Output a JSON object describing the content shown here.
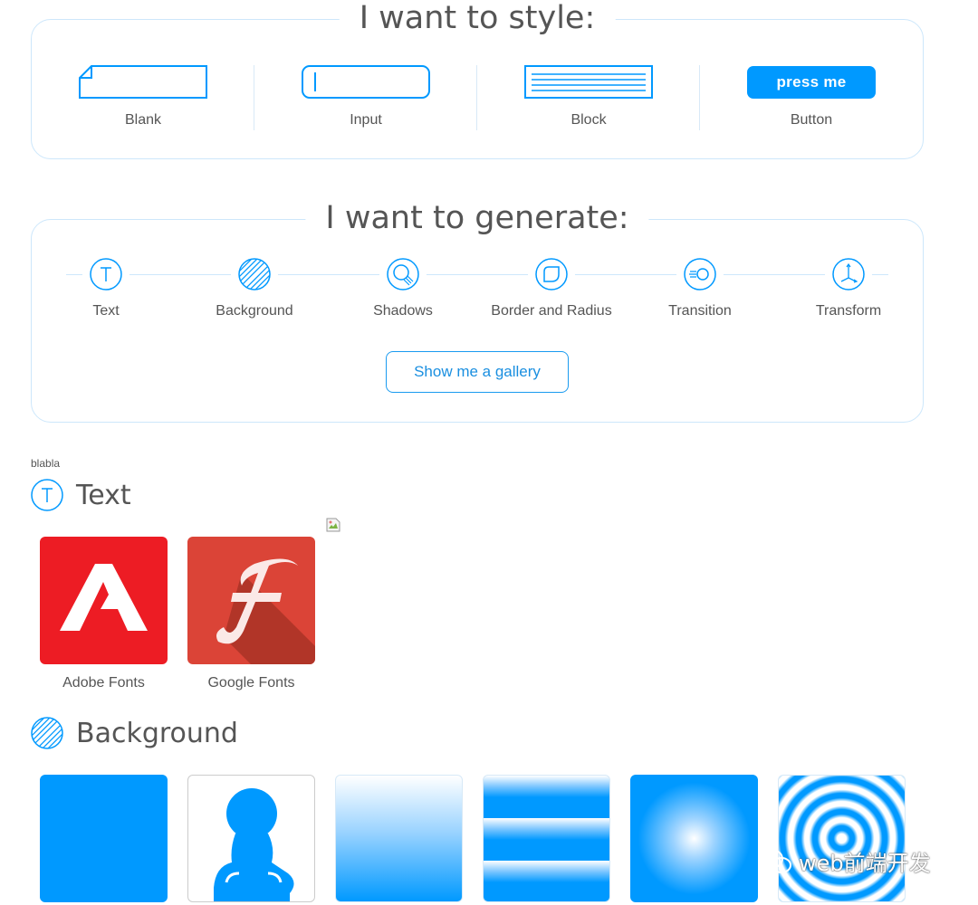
{
  "style_panel": {
    "title": "I want to style:",
    "options": [
      {
        "label": "Blank",
        "icon": "blank-page-icon"
      },
      {
        "label": "Input",
        "icon": "input-field-icon"
      },
      {
        "label": "Block",
        "icon": "text-block-icon"
      },
      {
        "label": "Button",
        "icon": "button-preview",
        "button_text": "press me"
      }
    ]
  },
  "gen_panel": {
    "title": "I want to generate:",
    "options": [
      {
        "label": "Text",
        "icon": "text-t-icon"
      },
      {
        "label": "Background",
        "icon": "hatched-circle-icon"
      },
      {
        "label": "Shadows",
        "icon": "shadow-circle-icon"
      },
      {
        "label": "Border and Radius",
        "icon": "rounded-square-icon"
      },
      {
        "label": "Transition",
        "icon": "transition-icon"
      },
      {
        "label": "Transform",
        "icon": "transform-axes-icon"
      }
    ],
    "gallery_button": "Show me a gallery"
  },
  "note": "blabla",
  "text_section": {
    "title": "Text",
    "tiles": [
      {
        "label": "Adobe Fonts",
        "logo_letter": "A"
      },
      {
        "label": "Google Fonts",
        "logo_letter": "F"
      }
    ]
  },
  "background_section": {
    "title": "Background",
    "tiles": [
      "solid-blue",
      "person-silhouette",
      "vertical-gradient",
      "stripes",
      "radial-glow",
      "concentric-rings"
    ]
  },
  "watermark": "web前端开发",
  "colors": {
    "accent": "#0099ff",
    "border": "#cde7fb",
    "text": "#555555",
    "adobe_red": "#ed1c24",
    "google_red": "#db4437"
  }
}
